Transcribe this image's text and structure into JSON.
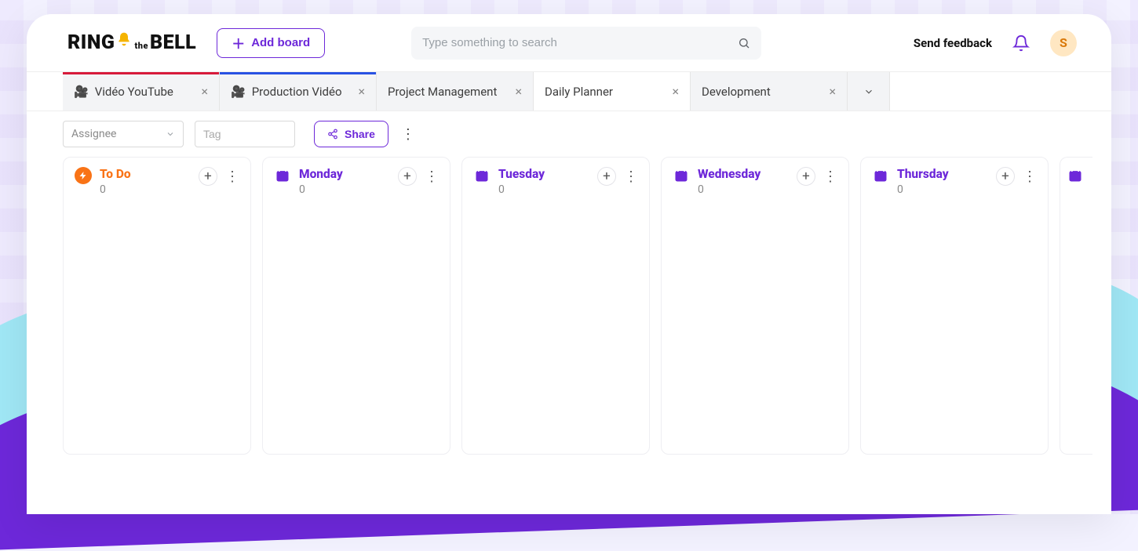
{
  "header": {
    "logo_parts": {
      "ring": "RING",
      "the": "the",
      "bell": "BELL"
    },
    "add_board_label": "Add board",
    "search_placeholder": "Type something to search",
    "feedback_label": "Send feedback",
    "avatar_initial": "S"
  },
  "tabs": [
    {
      "label": "Vidéo YouTube",
      "has_cam_icon": true,
      "stripe_color": "#d71b3b",
      "active": false
    },
    {
      "label": "Production Vidéo",
      "has_cam_icon": true,
      "stripe_color": "#2952e3",
      "active": false
    },
    {
      "label": "Project Management",
      "has_cam_icon": false,
      "stripe_color": "",
      "active": false
    },
    {
      "label": "Daily Planner",
      "has_cam_icon": false,
      "stripe_color": "",
      "active": true
    },
    {
      "label": "Development",
      "has_cam_icon": false,
      "stripe_color": "",
      "active": false
    }
  ],
  "toolbar": {
    "assignee_placeholder": "Assignee",
    "tag_placeholder": "Tag",
    "share_label": "Share"
  },
  "columns": [
    {
      "kind": "todo",
      "title": "To Do",
      "count": "0"
    },
    {
      "kind": "cal",
      "title": "Monday",
      "count": "0"
    },
    {
      "kind": "cal",
      "title": "Tuesday",
      "count": "0"
    },
    {
      "kind": "cal",
      "title": "Wednesday",
      "count": "0"
    },
    {
      "kind": "cal",
      "title": "Thursday",
      "count": "0"
    }
  ]
}
